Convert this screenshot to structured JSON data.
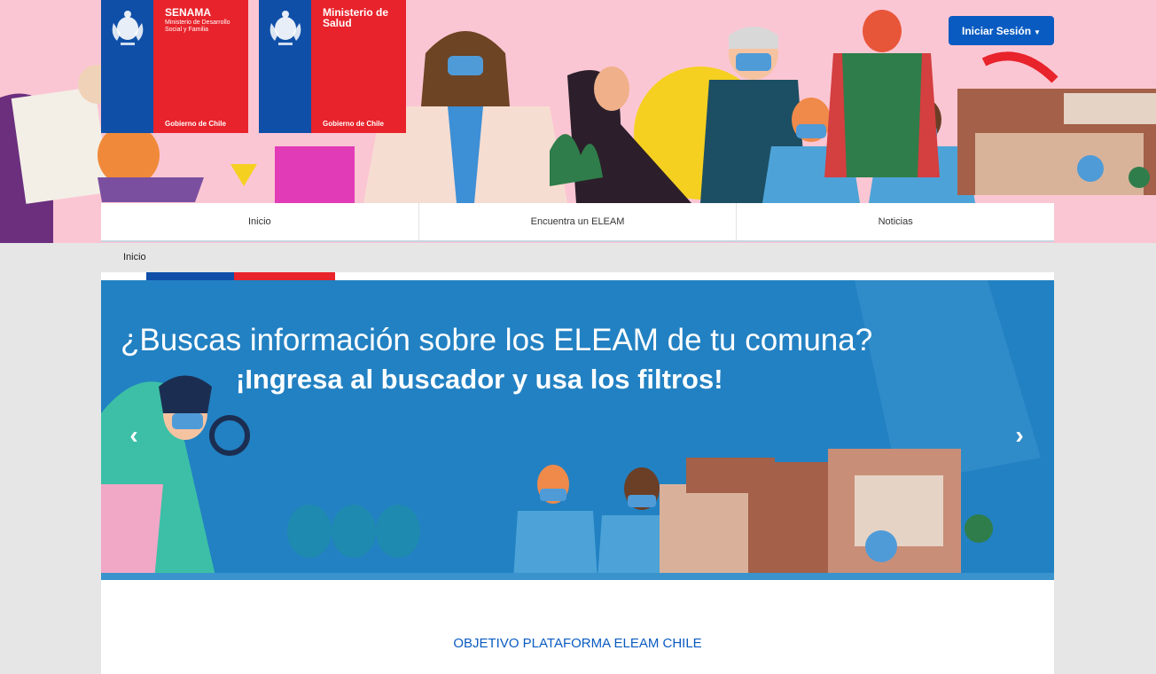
{
  "header": {
    "logos": [
      {
        "title": "SENAMA",
        "subtitle": "Ministerio de Desarrollo Social y Familia",
        "footer": "Gobierno de Chile"
      },
      {
        "title": "Ministerio de Salud",
        "subtitle": "",
        "footer": "Gobierno de Chile"
      }
    ],
    "login_label": "Iniciar Sesión"
  },
  "nav": {
    "items": [
      "Inicio",
      "Encuentra un ELEAM",
      "Noticias"
    ]
  },
  "breadcrumb": "Inicio",
  "carousel": {
    "line1": "¿Buscas información sobre los ELEAM de tu comuna?",
    "line2": "¡Ingresa al buscador y usa los filtros!"
  },
  "section": {
    "title": "OBJETIVO PLATAFORMA ELEAM CHILE"
  },
  "colors": {
    "header_bg": "#fbc6d3",
    "gov_blue": "#0f4fa8",
    "gov_red": "#e8232b",
    "button_blue": "#0a5bc1",
    "carousel_bg": "#2281c2"
  },
  "icons": {
    "seal": "chile-coat-of-arms-icon",
    "carousel_prev": "chevron-left-icon",
    "carousel_next": "chevron-right-icon",
    "dropdown": "caret-down-icon"
  }
}
